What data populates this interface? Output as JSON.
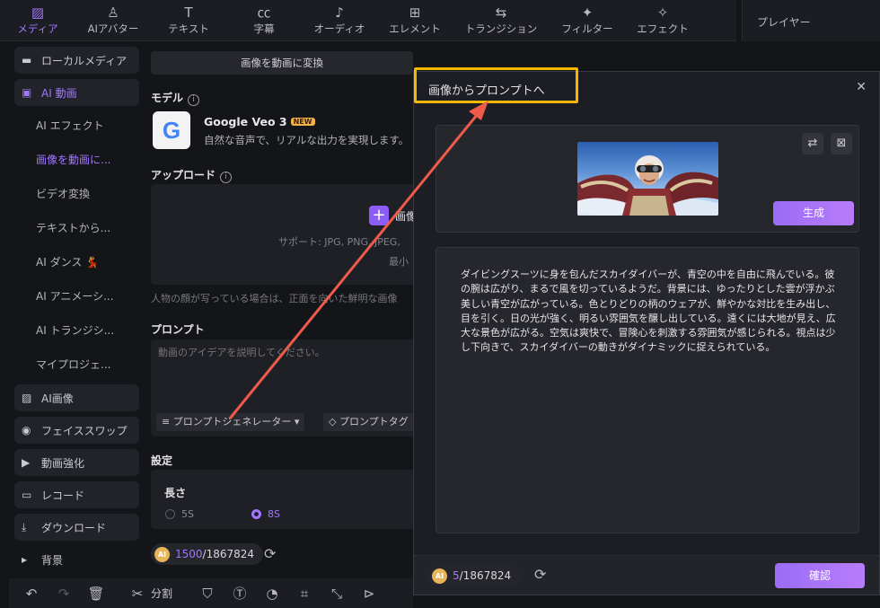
{
  "toolbar": {
    "tabs": [
      {
        "label": "メディア",
        "icon": "media-icon",
        "glyph": "▨"
      },
      {
        "label": "AIアバター",
        "icon": "avatar-icon",
        "glyph": "♙"
      },
      {
        "label": "テキスト",
        "icon": "text-icon",
        "glyph": "T"
      },
      {
        "label": "字幕",
        "icon": "caption-icon",
        "glyph": "㏄"
      },
      {
        "label": "オーディオ",
        "icon": "audio-icon",
        "glyph": "♪"
      },
      {
        "label": "エレメント",
        "icon": "element-icon",
        "glyph": "⊞"
      },
      {
        "label": "トランジション",
        "icon": "transition-icon",
        "glyph": "⇆"
      },
      {
        "label": "フィルター",
        "icon": "filter-icon",
        "glyph": "✦"
      },
      {
        "label": "エフェクト",
        "icon": "effect-icon",
        "glyph": "✧"
      }
    ],
    "active_color": "#a276ff"
  },
  "player": {
    "title": "プレイヤー"
  },
  "sidebar": {
    "local_media": "ローカルメディア",
    "ai_video": "AI 動画",
    "subs": [
      "AI エフェクト",
      "画像を動画に...",
      "ビデオ変換",
      "テキストから...",
      "AI ダンス 💃",
      "AI アニメーシ...",
      "AI トランジシ...",
      "マイプロジェ..."
    ],
    "ai_image": "AI画像",
    "face_swap": "フェイススワップ",
    "enhance": "動画強化",
    "record": "レコード",
    "download": "ダウンロード",
    "background": "背景"
  },
  "panel": {
    "convert_tab": "画像を動画に変換",
    "model_label": "モデル",
    "model_name": "Google Veo 3",
    "model_badge": "NEW",
    "model_desc": "自然な音声で、リアルな出力を実現します。",
    "upload_label": "アップロード",
    "upload_btn": "画像",
    "upload_support": "サポート: JPG, PNG, JPEG,",
    "upload_min": "最小",
    "face_note": "人物の顔が写っている場合は、正面を向いた鮮明な画像",
    "prompt_label": "プロンプト",
    "prompt_placeholder": "動画のアイデアを説明してください。",
    "prompt_generator": "プロンプトジェネレーター",
    "prompt_tag": "プロンプトタグ",
    "settings_label": "設定",
    "length_label": "長さ",
    "opt_5s": "5S",
    "opt_8s": "8S",
    "credits_used": "1500",
    "credits_total": "/1867824"
  },
  "bottombar": {
    "split_label": "分割"
  },
  "modal": {
    "title": "画像からプロンプトへ",
    "generate_btn": "生成",
    "generated_text": "ダイビングスーツに身を包んだスカイダイバーが、青空の中を自由に飛んでいる。彼の腕は広がり、まるで風を切っているようだ。背景には、ゆったりとした雲が浮かぶ美しい青空が広がっている。色とりどりの柄のウェアが、鮮やかな対比を生み出し、目を引く。日の光が強く、明るい雰囲気を醸し出している。遠くには大地が見え、広大な景色が広がる。空気は爽快で、冒険心を刺激する雰囲気が感じられる。視点は少し下向きで、スカイダイバーの動きがダイナミックに捉えられている。",
    "credits_used": "5",
    "credits_total": "/1867824",
    "confirm_btn": "確認",
    "highlight_color": "#f5b800"
  }
}
